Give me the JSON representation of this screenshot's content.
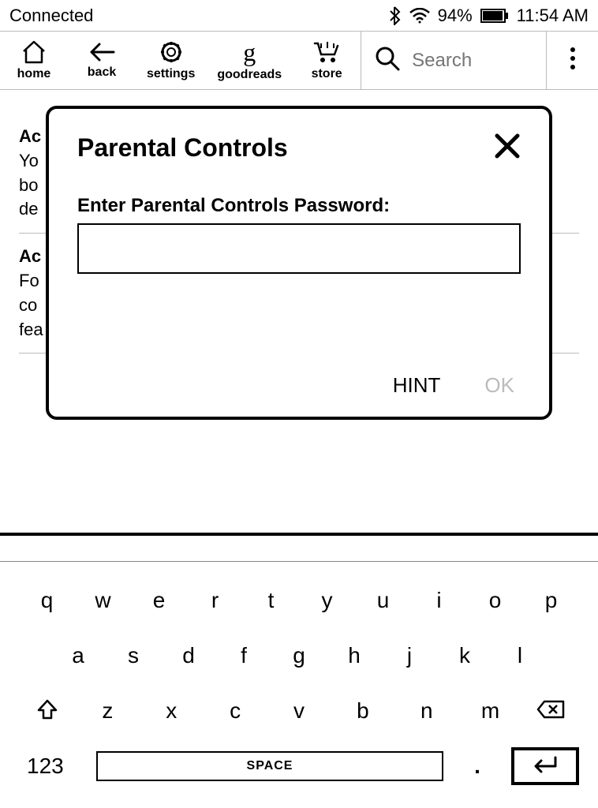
{
  "status": {
    "connection": "Connected",
    "battery_pct": "94%",
    "time": "11:54 AM"
  },
  "toolbar": {
    "home": "home",
    "back": "back",
    "settings": "settings",
    "goodreads": "goodreads",
    "store": "store",
    "search_placeholder": "Search"
  },
  "bg": {
    "item1": {
      "title": "Ac",
      "line1": "Yo",
      "line2": "bo",
      "line3": "de"
    },
    "item2": {
      "title": "Ac",
      "line1": "Fo",
      "line2": "co",
      "line3": "fea"
    }
  },
  "modal": {
    "title": "Parental Controls",
    "label": "Enter Parental Controls Password:",
    "input_value": "",
    "hint": "HINT",
    "ok": "OK"
  },
  "keyboard": {
    "row1": [
      "q",
      "w",
      "e",
      "r",
      "t",
      "y",
      "u",
      "i",
      "o",
      "p"
    ],
    "row2": [
      "a",
      "s",
      "d",
      "f",
      "g",
      "h",
      "j",
      "k",
      "l"
    ],
    "row3": [
      "z",
      "x",
      "c",
      "v",
      "b",
      "n",
      "m"
    ],
    "numKey": "123",
    "space": "SPACE",
    "period": "."
  }
}
